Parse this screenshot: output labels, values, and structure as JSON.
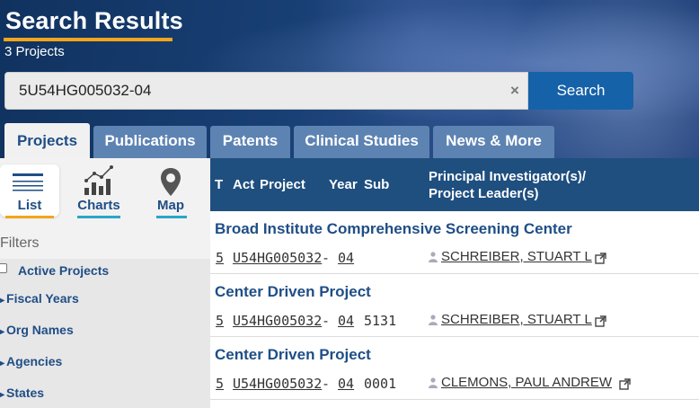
{
  "header": {
    "title": "Search Results",
    "subtitle": "3 Projects"
  },
  "search": {
    "value": "5U54HG005032-04",
    "clear_label": "×",
    "button_label": "Search"
  },
  "tabs": [
    {
      "label": "Projects",
      "active": true
    },
    {
      "label": "Publications",
      "active": false
    },
    {
      "label": "Patents",
      "active": false
    },
    {
      "label": "Clinical Studies",
      "active": false
    },
    {
      "label": "News & More",
      "active": false
    }
  ],
  "views": [
    {
      "label": "List",
      "icon": "list-icon",
      "active": true
    },
    {
      "label": "Charts",
      "icon": "chart-icon",
      "active": false
    },
    {
      "label": "Map",
      "icon": "map-pin-icon",
      "active": false
    }
  ],
  "filters": {
    "heading": "Filters",
    "active_projects_label": "Active Projects",
    "items": [
      "Fiscal Years",
      "Org Names",
      "Agencies",
      "States"
    ]
  },
  "table": {
    "columns": {
      "type": "T",
      "activity": "Act",
      "project": "Project",
      "year": "Year",
      "sub": "Sub",
      "pi_line1": "Principal Investigator(s)/",
      "pi_line2": "Project Leader(s)"
    },
    "rows": [
      {
        "title": "Broad Institute Comprehensive Screening Center",
        "type": "5",
        "activity": "U54",
        "project": "HG005032",
        "year": "04",
        "sub": "",
        "pi": "SCHREIBER, STUART L"
      },
      {
        "title": "Center Driven Project",
        "type": "5",
        "activity": "U54",
        "project": "HG005032",
        "year": "04",
        "sub": "5131",
        "pi": "SCHREIBER, STUART L"
      },
      {
        "title": "Center Driven Project",
        "type": "5",
        "activity": "U54",
        "project": "HG005032",
        "year": "04",
        "sub": "0001",
        "pi": "CLEMONS, PAUL ANDREW"
      }
    ]
  },
  "colors": {
    "accent_orange": "#f3a51b",
    "link_blue": "#1f4e86",
    "tab_inactive": "#5d83b3",
    "table_header": "#1f4f7f",
    "search_button": "#1662a8"
  }
}
